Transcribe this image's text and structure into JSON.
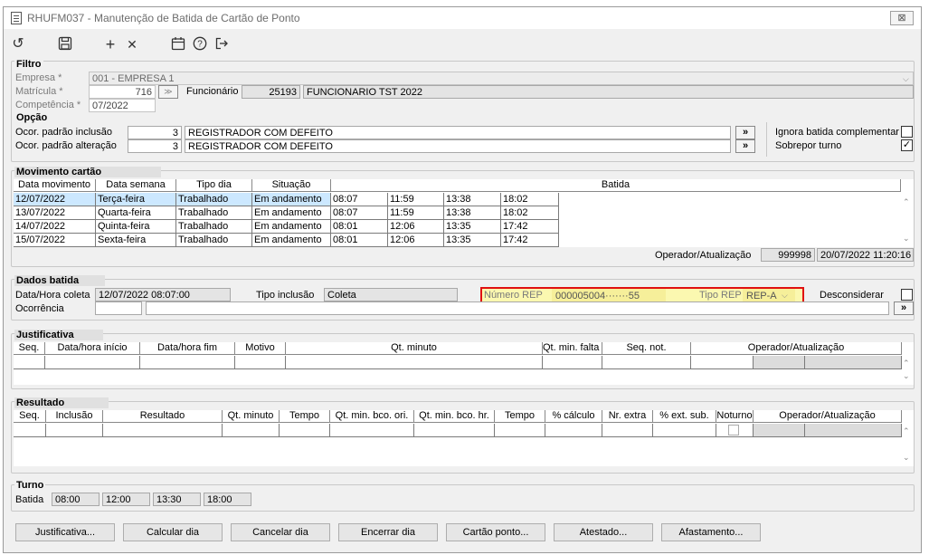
{
  "window": {
    "title": "RHUFM037 - Manutenção de Batida de Cartão de Ponto",
    "close": "⊠"
  },
  "toolbar": {
    "undo": "↺",
    "save": "💾",
    "add": "+",
    "delete": "✕",
    "calendar": "📅",
    "help": "?",
    "exit": "⇥"
  },
  "filtro": {
    "label": "Filtro",
    "empresa_label": "Empresa *",
    "empresa_value": "001 - EMPRESA 1",
    "matricula_label": "Matrícula *",
    "matricula_value": "716",
    "funcionario_label": "Funcionário",
    "funcionario_code": "25193",
    "funcionario_name": "FUNCIONARIO TST 2022",
    "competencia_label": "Competência *",
    "competencia_value": "07/2022"
  },
  "opcao": {
    "label": "Opção",
    "inclusao_label": "Ocor. padrão inclusão",
    "inclusao_code": "3",
    "inclusao_desc": "REGISTRADOR COM DEFEITO",
    "alteracao_label": "Ocor. padrão alteração",
    "alteracao_code": "3",
    "alteracao_desc": "REGISTRADOR COM DEFEITO",
    "ignora_label": "Ignora batida complementar",
    "sobrepor_label": "Sobrepor turno",
    "lookup": "»"
  },
  "movimento": {
    "label": "Movimento cartão",
    "headers": [
      "Data movimento",
      "Data semana",
      "Tipo dia",
      "Situação",
      "Batida"
    ],
    "rows": [
      {
        "data": "12/07/2022",
        "semana": "Terça-feira",
        "tipo": "Trabalhado",
        "situacao": "Em andamento",
        "b1": "08:07",
        "b2": "11:59",
        "b3": "13:38",
        "b4": "18:02"
      },
      {
        "data": "13/07/2022",
        "semana": "Quarta-feira",
        "tipo": "Trabalhado",
        "situacao": "Em andamento",
        "b1": "08:07",
        "b2": "11:59",
        "b3": "13:38",
        "b4": "18:02"
      },
      {
        "data": "14/07/2022",
        "semana": "Quinta-feira",
        "tipo": "Trabalhado",
        "situacao": "Em andamento",
        "b1": "08:01",
        "b2": "12:06",
        "b3": "13:35",
        "b4": "17:42"
      },
      {
        "data": "15/07/2022",
        "semana": "Sexta-feira",
        "tipo": "Trabalhado",
        "situacao": "Em andamento",
        "b1": "08:01",
        "b2": "12:06",
        "b3": "13:35",
        "b4": "17:42"
      }
    ],
    "operador_label": "Operador/Atualização",
    "operador_value": "999998",
    "atualizacao_value": "20/07/2022 11:20:16"
  },
  "dados": {
    "label": "Dados batida",
    "datahora_label": "Data/Hora coleta",
    "datahora_value": "12/07/2022 08:07:00",
    "tipo_inclusao_label": "Tipo inclusão",
    "tipo_inclusao_value": "Coleta",
    "numero_rep_label": "Número REP",
    "numero_rep_value": "000005004·······55",
    "tipo_rep_label": "Tipo REP",
    "tipo_rep_value": "REP-A",
    "desconsiderar_label": "Desconsiderar",
    "ocorrencia_label": "Ocorrência"
  },
  "justificativa": {
    "label": "Justificativa",
    "headers": [
      "Seq.",
      "Data/hora início",
      "Data/hora fim",
      "Motivo",
      "Qt. minuto",
      "Qt. min. falta bco.",
      "Seq. not.",
      "Operador/Atualização"
    ]
  },
  "resultado": {
    "label": "Resultado",
    "headers": [
      "Seq.",
      "Inclusão",
      "Resultado",
      "Qt. minuto",
      "Tempo",
      "Qt. min. bco. ori.",
      "Qt. min. bco. hr.",
      "Tempo",
      "% cálculo",
      "Nr. extra",
      "% ext. sub.",
      "Noturno",
      "Operador/Atualização"
    ]
  },
  "turno": {
    "label": "Turno",
    "batida_label": "Batida",
    "values": [
      "08:00",
      "12:00",
      "13:30",
      "18:00"
    ]
  },
  "buttons": [
    "Justificativa...",
    "Calcular dia",
    "Cancelar dia",
    "Encerrar dia",
    "Cartão ponto...",
    "Atestado...",
    "Afastamento..."
  ]
}
